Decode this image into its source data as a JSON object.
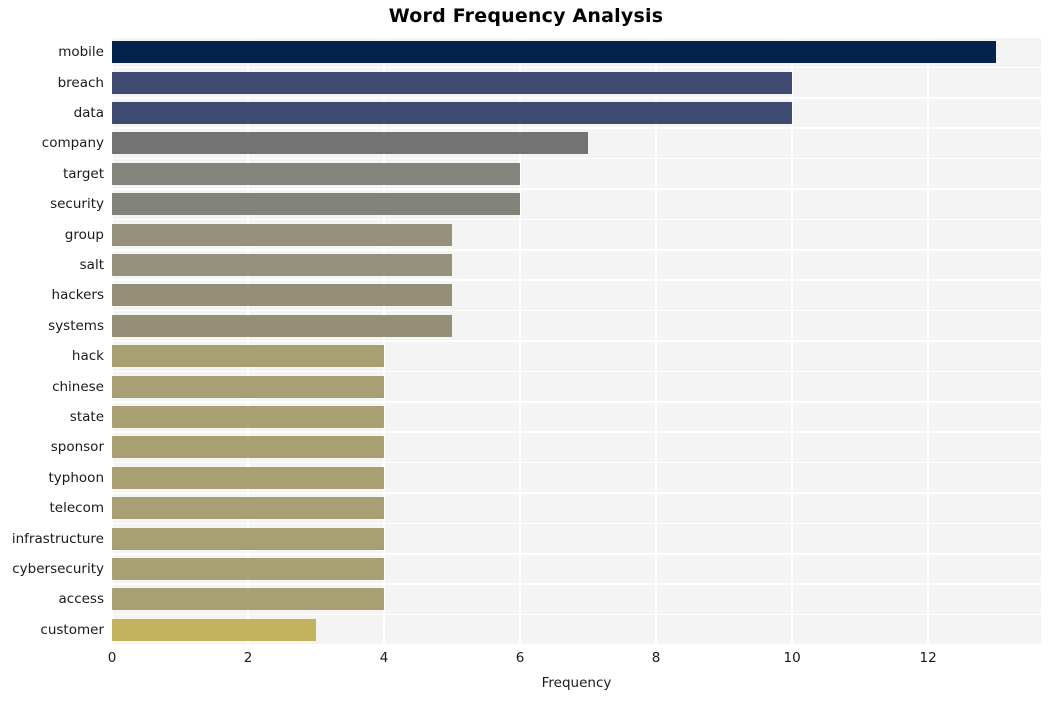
{
  "chart_data": {
    "type": "bar",
    "orientation": "horizontal",
    "title": "Word Frequency Analysis",
    "xlabel": "Frequency",
    "ylabel": "",
    "categories": [
      "mobile",
      "breach",
      "data",
      "company",
      "target",
      "security",
      "group",
      "salt",
      "hackers",
      "systems",
      "hack",
      "chinese",
      "state",
      "sponsor",
      "typhoon",
      "telecom",
      "infrastructure",
      "cybersecurity",
      "access",
      "customer"
    ],
    "values": [
      13,
      10,
      10,
      7,
      6,
      6,
      5,
      5,
      5,
      5,
      4,
      4,
      4,
      4,
      4,
      4,
      4,
      4,
      4,
      3
    ],
    "bar_colors": [
      "#04234c",
      "#3f4b70",
      "#3e4a6f",
      "#737376",
      "#84847d",
      "#838379",
      "#95917a",
      "#95917a",
      "#958f78",
      "#958f78",
      "#a89f72",
      "#a89f72",
      "#a89f72",
      "#a89f72",
      "#a89f72",
      "#a89f72",
      "#a89f72",
      "#a89f72",
      "#a89f72",
      "#c3b35f"
    ],
    "xlim": [
      0,
      13.66
    ],
    "x_ticks": [
      0,
      2,
      4,
      6,
      8,
      10,
      12
    ],
    "x_tick_labels": [
      "0",
      "2",
      "4",
      "6",
      "8",
      "10",
      "12"
    ],
    "grid": true,
    "grid_color": "#ffffff",
    "plot_background": "#f4f4f5",
    "figure_background": "#ffffff",
    "legend": null
  }
}
